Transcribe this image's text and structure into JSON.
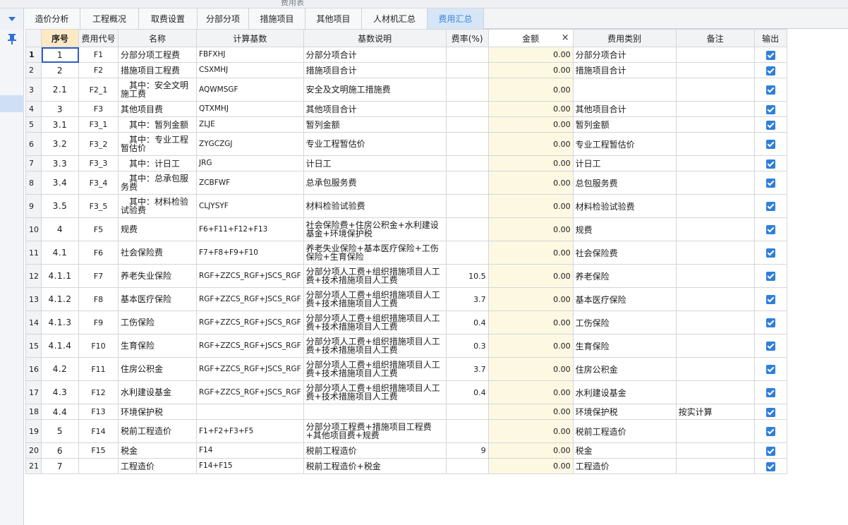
{
  "window": {
    "title": "费用表"
  },
  "tabs": [
    {
      "label": "造价分析",
      "active": false
    },
    {
      "label": "工程概况",
      "active": false
    },
    {
      "label": "取费设置",
      "active": false
    },
    {
      "label": "分部分项",
      "active": false
    },
    {
      "label": "措施项目",
      "active": false
    },
    {
      "label": "其他项目",
      "active": false
    },
    {
      "label": "人材机汇总",
      "active": false
    },
    {
      "label": "费用汇总",
      "active": true
    }
  ],
  "colors": {
    "accent": "#3f83d8",
    "checkbox": "#2f7fdb",
    "amount_bg": "#fdf8e2",
    "seq_header_bg": "#fde9c4"
  },
  "icons": {
    "sidebar_pin": "pin-icon",
    "tab_menu": "triangle-down-icon",
    "close": "close-icon",
    "checkbox": "checkbox-checked-icon"
  },
  "table": {
    "headers": {
      "seq": "序号",
      "code": "费用代号",
      "name": "名称",
      "base": "计算基数",
      "desc": "基数说明",
      "rate": "费率(%)",
      "amount": "金额",
      "category": "费用类别",
      "note": "备注",
      "output": "输出"
    },
    "amount_close": "×",
    "rows": [
      {
        "rn": "1",
        "seq": "1",
        "code": "F1",
        "name": "分部分项工程费",
        "base": "FBFXHJ",
        "desc": "分部分项合计",
        "rate": "",
        "amount": "0.00",
        "category": "分部分项合计",
        "note": "",
        "output": true
      },
      {
        "rn": "2",
        "seq": "2",
        "code": "F2",
        "name": "措施项目工程费",
        "base": "CSXMHJ",
        "desc": "措施项目合计",
        "rate": "",
        "amount": "0.00",
        "category": "措施项目合计",
        "note": "",
        "output": true
      },
      {
        "rn": "3",
        "seq": "2.1",
        "code": "F2_1",
        "name": "　其中：安全文明施工费",
        "base": "AQWMSGF",
        "desc": "安全及文明施工措施费",
        "rate": "",
        "amount": "0.00",
        "category": "",
        "note": "",
        "output": true
      },
      {
        "rn": "4",
        "seq": "3",
        "code": "F3",
        "name": "其他项目费",
        "base": "QTXMHJ",
        "desc": "其他项目合计",
        "rate": "",
        "amount": "0.00",
        "category": "其他项目合计",
        "note": "",
        "output": true
      },
      {
        "rn": "5",
        "seq": "3.1",
        "code": "F3_1",
        "name": "　其中：暂列金额",
        "base": "ZLJE",
        "desc": "暂列金额",
        "rate": "",
        "amount": "0.00",
        "category": "暂列金额",
        "note": "",
        "output": true
      },
      {
        "rn": "6",
        "seq": "3.2",
        "code": "F3_2",
        "name": "　其中：专业工程暂估价",
        "base": "ZYGCZGJ",
        "desc": "专业工程暂估价",
        "rate": "",
        "amount": "0.00",
        "category": "专业工程暂估价",
        "note": "",
        "output": true
      },
      {
        "rn": "7",
        "seq": "3.3",
        "code": "F3_3",
        "name": "　其中：计日工",
        "base": "JRG",
        "desc": "计日工",
        "rate": "",
        "amount": "0.00",
        "category": "计日工",
        "note": "",
        "output": true
      },
      {
        "rn": "8",
        "seq": "3.4",
        "code": "F3_4",
        "name": "　其中：总承包服务费",
        "base": "ZCBFWF",
        "desc": "总承包服务费",
        "rate": "",
        "amount": "0.00",
        "category": "总包服务费",
        "note": "",
        "output": true
      },
      {
        "rn": "9",
        "seq": "3.5",
        "code": "F3_5",
        "name": "　其中：材料检验试验费",
        "base": "CLJYSYF",
        "desc": "材料检验试验费",
        "rate": "",
        "amount": "0.00",
        "category": "材料检验试验费",
        "note": "",
        "output": true
      },
      {
        "rn": "10",
        "seq": "4",
        "code": "F5",
        "name": "规费",
        "base": "F6+F11+F12+F13",
        "desc": "社会保险费+住房公积金+水利建设基金+环境保护税",
        "rate": "",
        "amount": "0.00",
        "category": "规费",
        "note": "",
        "output": true
      },
      {
        "rn": "11",
        "seq": "4.1",
        "code": "F6",
        "name": "社会保险费",
        "base": "F7+F8+F9+F10",
        "desc": "养老失业保险+基本医疗保险+工伤保险+生育保险",
        "rate": "",
        "amount": "0.00",
        "category": "社会保险费",
        "note": "",
        "output": true
      },
      {
        "rn": "12",
        "seq": "4.1.1",
        "code": "F7",
        "name": "养老失业保险",
        "base": "RGF+ZZCS_RGF+JSCS_RGF",
        "desc": "分部分项人工费+组织措施项目人工费+技术措施项目人工费",
        "rate": "10.5",
        "amount": "0.00",
        "category": "养老保险",
        "note": "",
        "output": true
      },
      {
        "rn": "13",
        "seq": "4.1.2",
        "code": "F8",
        "name": "基本医疗保险",
        "base": "RGF+ZZCS_RGF+JSCS_RGF",
        "desc": "分部分项人工费+组织措施项目人工费+技术措施项目人工费",
        "rate": "3.7",
        "amount": "0.00",
        "category": "基本医疗保险",
        "note": "",
        "output": true
      },
      {
        "rn": "14",
        "seq": "4.1.3",
        "code": "F9",
        "name": "工伤保险",
        "base": "RGF+ZZCS_RGF+JSCS_RGF",
        "desc": "分部分项人工费+组织措施项目人工费+技术措施项目人工费",
        "rate": "0.4",
        "amount": "0.00",
        "category": "工伤保险",
        "note": "",
        "output": true
      },
      {
        "rn": "15",
        "seq": "4.1.4",
        "code": "F10",
        "name": "生育保险",
        "base": "RGF+ZZCS_RGF+JSCS_RGF",
        "desc": "分部分项人工费+组织措施项目人工费+技术措施项目人工费",
        "rate": "0.3",
        "amount": "0.00",
        "category": "生育保险",
        "note": "",
        "output": true
      },
      {
        "rn": "16",
        "seq": "4.2",
        "code": "F11",
        "name": "住房公积金",
        "base": "RGF+ZZCS_RGF+JSCS_RGF",
        "desc": "分部分项人工费+组织措施项目人工费+技术措施项目人工费",
        "rate": "3.7",
        "amount": "0.00",
        "category": "住房公积金",
        "note": "",
        "output": true
      },
      {
        "rn": "17",
        "seq": "4.3",
        "code": "F12",
        "name": "水利建设基金",
        "base": "RGF+ZZCS_RGF+JSCS_RGF",
        "desc": "分部分项人工费+组织措施项目人工费+技术措施项目人工费",
        "rate": "0.4",
        "amount": "0.00",
        "category": "水利建设基金",
        "note": "",
        "output": true
      },
      {
        "rn": "18",
        "seq": "4.4",
        "code": "F13",
        "name": "环境保护税",
        "base": "",
        "desc": "",
        "rate": "",
        "amount": "0.00",
        "category": "环境保护税",
        "note": "按实计算",
        "output": true
      },
      {
        "rn": "19",
        "seq": "5",
        "code": "F14",
        "name": "税前工程造价",
        "base": "F1+F2+F3+F5",
        "desc": "分部分项工程费+措施项目工程费+其他项目费+规费",
        "rate": "",
        "amount": "0.00",
        "category": "税前工程造价",
        "note": "",
        "output": true
      },
      {
        "rn": "20",
        "seq": "6",
        "code": "F15",
        "name": "税金",
        "base": "F14",
        "desc": "税前工程造价",
        "rate": "9",
        "amount": "0.00",
        "category": "税金",
        "note": "",
        "output": true
      },
      {
        "rn": "21",
        "seq": "7",
        "code": "",
        "name": "工程造价",
        "base": "F14+F15",
        "desc": "税前工程造价+税金",
        "rate": "",
        "amount": "0.00",
        "category": "工程造价",
        "note": "",
        "output": true
      }
    ]
  }
}
